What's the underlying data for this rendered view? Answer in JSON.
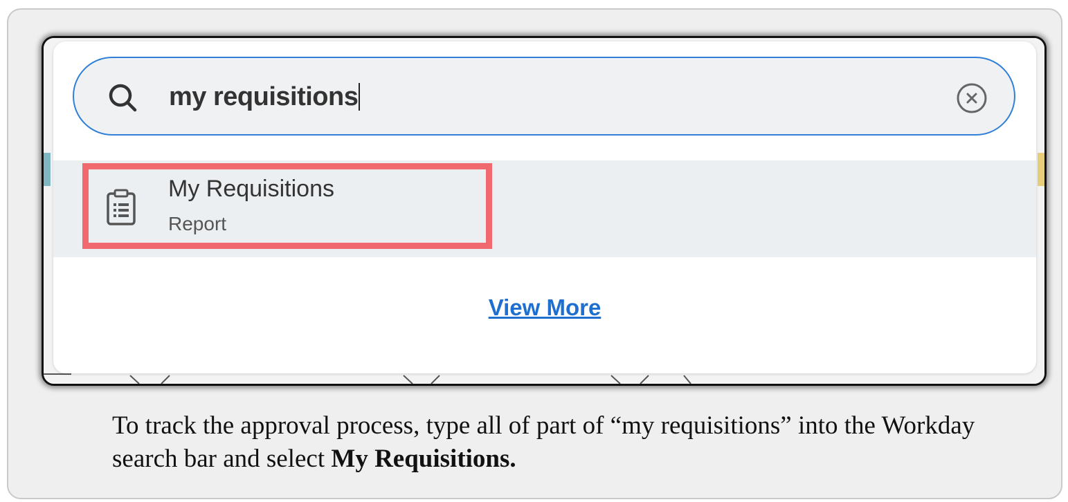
{
  "search": {
    "value": "my requisitions",
    "icon": "search-icon",
    "clear_icon": "clear-circle-icon"
  },
  "results": [
    {
      "title": "My Requisitions",
      "subtitle": "Report",
      "icon": "report-clipboard-icon",
      "highlighted": true
    }
  ],
  "view_more_label": "View More",
  "caption": {
    "text_before": "To track the approval process, type all of part of “my requisitions” into the Workday search bar and select ",
    "bold_text": "My Requisitions."
  },
  "colors": {
    "search_border": "#2f7fd8",
    "highlight": "#f0696f",
    "link": "#1f6fd0"
  }
}
